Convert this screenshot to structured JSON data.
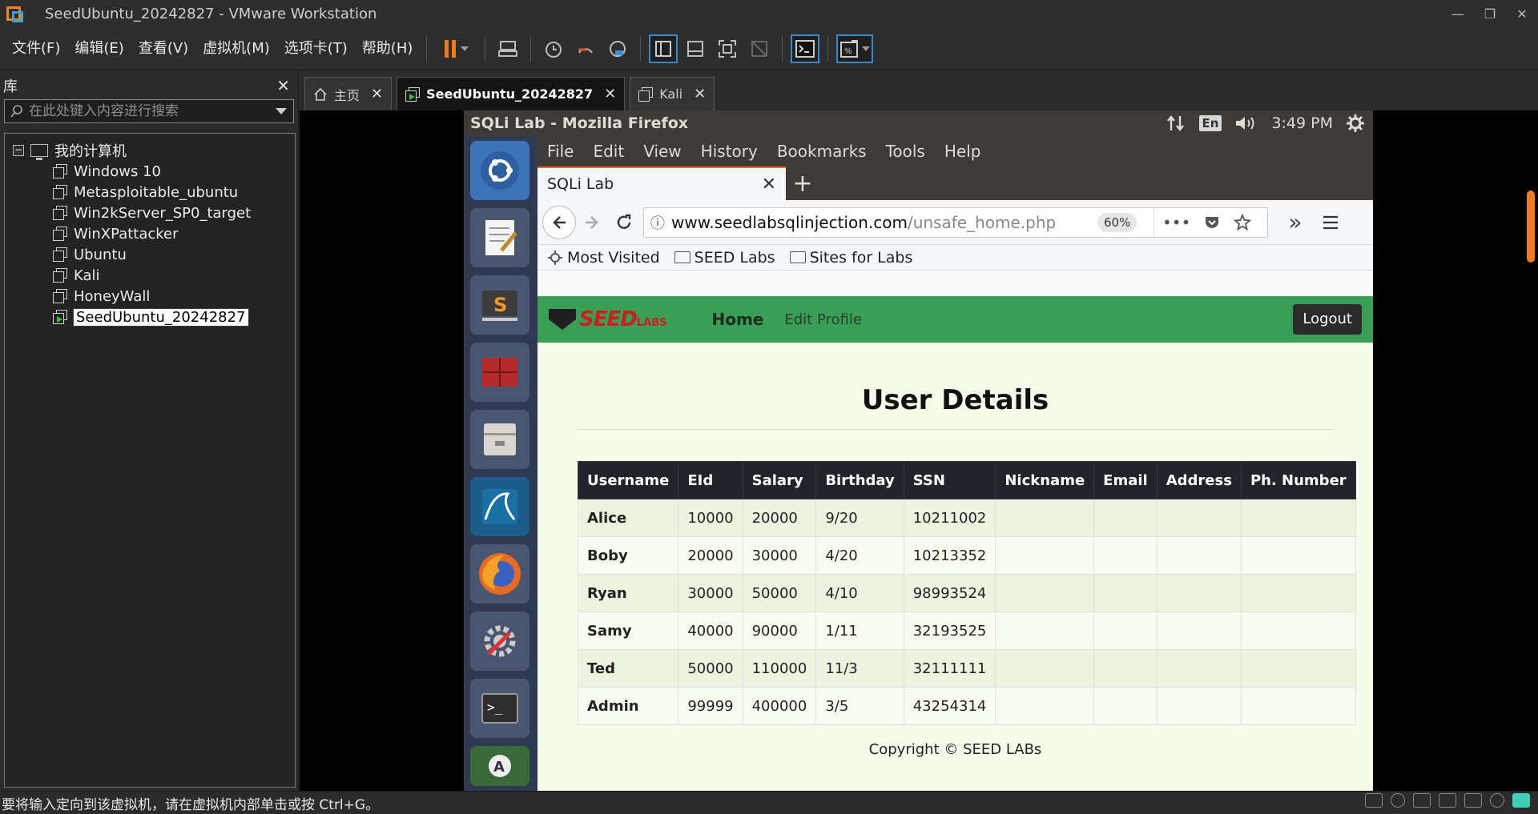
{
  "window": {
    "title": "SeedUbuntu_20242827 - VMware Workstation",
    "controls": [
      "—",
      "❐",
      "✕"
    ]
  },
  "menu": {
    "items": [
      "文件(F)",
      "编辑(E)",
      "查看(V)",
      "虚拟机(M)",
      "选项卡(T)",
      "帮助(H)"
    ]
  },
  "library": {
    "title": "库",
    "search_placeholder": "在此处键入内容进行搜索",
    "root_label": "我的计算机",
    "vms": [
      "Windows 10",
      "Metasploitable_ubuntu",
      "Win2kServer_SP0_target",
      "WinXPattacker",
      "Ubuntu",
      "Kali",
      "HoneyWall",
      "SeedUbuntu_20242827"
    ],
    "selected": "SeedUbuntu_20242827"
  },
  "vm_tabs": [
    {
      "label": "主页",
      "active": false
    },
    {
      "label": "SeedUbuntu_20242827",
      "active": true
    },
    {
      "label": "Kali",
      "active": false
    }
  ],
  "guest": {
    "window_title": "SQLi Lab - Mozilla Firefox",
    "lang": "En",
    "clock": "3:49 PM"
  },
  "firefox": {
    "menus": [
      "File",
      "Edit",
      "View",
      "History",
      "Bookmarks",
      "Tools",
      "Help"
    ],
    "tab_title": "SQLi Lab",
    "url_host": "www.seedlabsqlinjection.com",
    "url_path": "/unsafe_home.php",
    "zoom": "60%",
    "bookmarks": [
      "Most Visited",
      "SEED Labs",
      "Sites for Labs"
    ]
  },
  "site": {
    "logo_text": "SEED",
    "logo_sub": "LABS",
    "nav_home": "Home",
    "nav_edit": "Edit Profile",
    "logout": "Logout",
    "page_title": "User Details",
    "table": {
      "headers": [
        "Username",
        "EId",
        "Salary",
        "Birthday",
        "SSN",
        "Nickname",
        "Email",
        "Address",
        "Ph. Number"
      ],
      "rows": [
        [
          "Alice",
          "10000",
          "20000",
          "9/20",
          "10211002",
          "",
          "",
          "",
          ""
        ],
        [
          "Boby",
          "20000",
          "30000",
          "4/20",
          "10213352",
          "",
          "",
          "",
          ""
        ],
        [
          "Ryan",
          "30000",
          "50000",
          "4/10",
          "98993524",
          "",
          "",
          "",
          ""
        ],
        [
          "Samy",
          "40000",
          "90000",
          "1/11",
          "32193525",
          "",
          "",
          "",
          ""
        ],
        [
          "Ted",
          "50000",
          "110000",
          "11/3",
          "32111111",
          "",
          "",
          "",
          ""
        ],
        [
          "Admin",
          "99999",
          "400000",
          "3/5",
          "43254314",
          "",
          "",
          "",
          ""
        ]
      ]
    },
    "copyright": "Copyright © SEED LABs"
  },
  "status": {
    "text": "要将输入定向到该虚拟机，请在虚拟机内部单击或按 Ctrl+G。"
  },
  "colors": {
    "accent_orange": "#f07b1a",
    "site_green": "#3a9f56",
    "page_bg": "#f4fde9",
    "table_header": "#212529"
  }
}
